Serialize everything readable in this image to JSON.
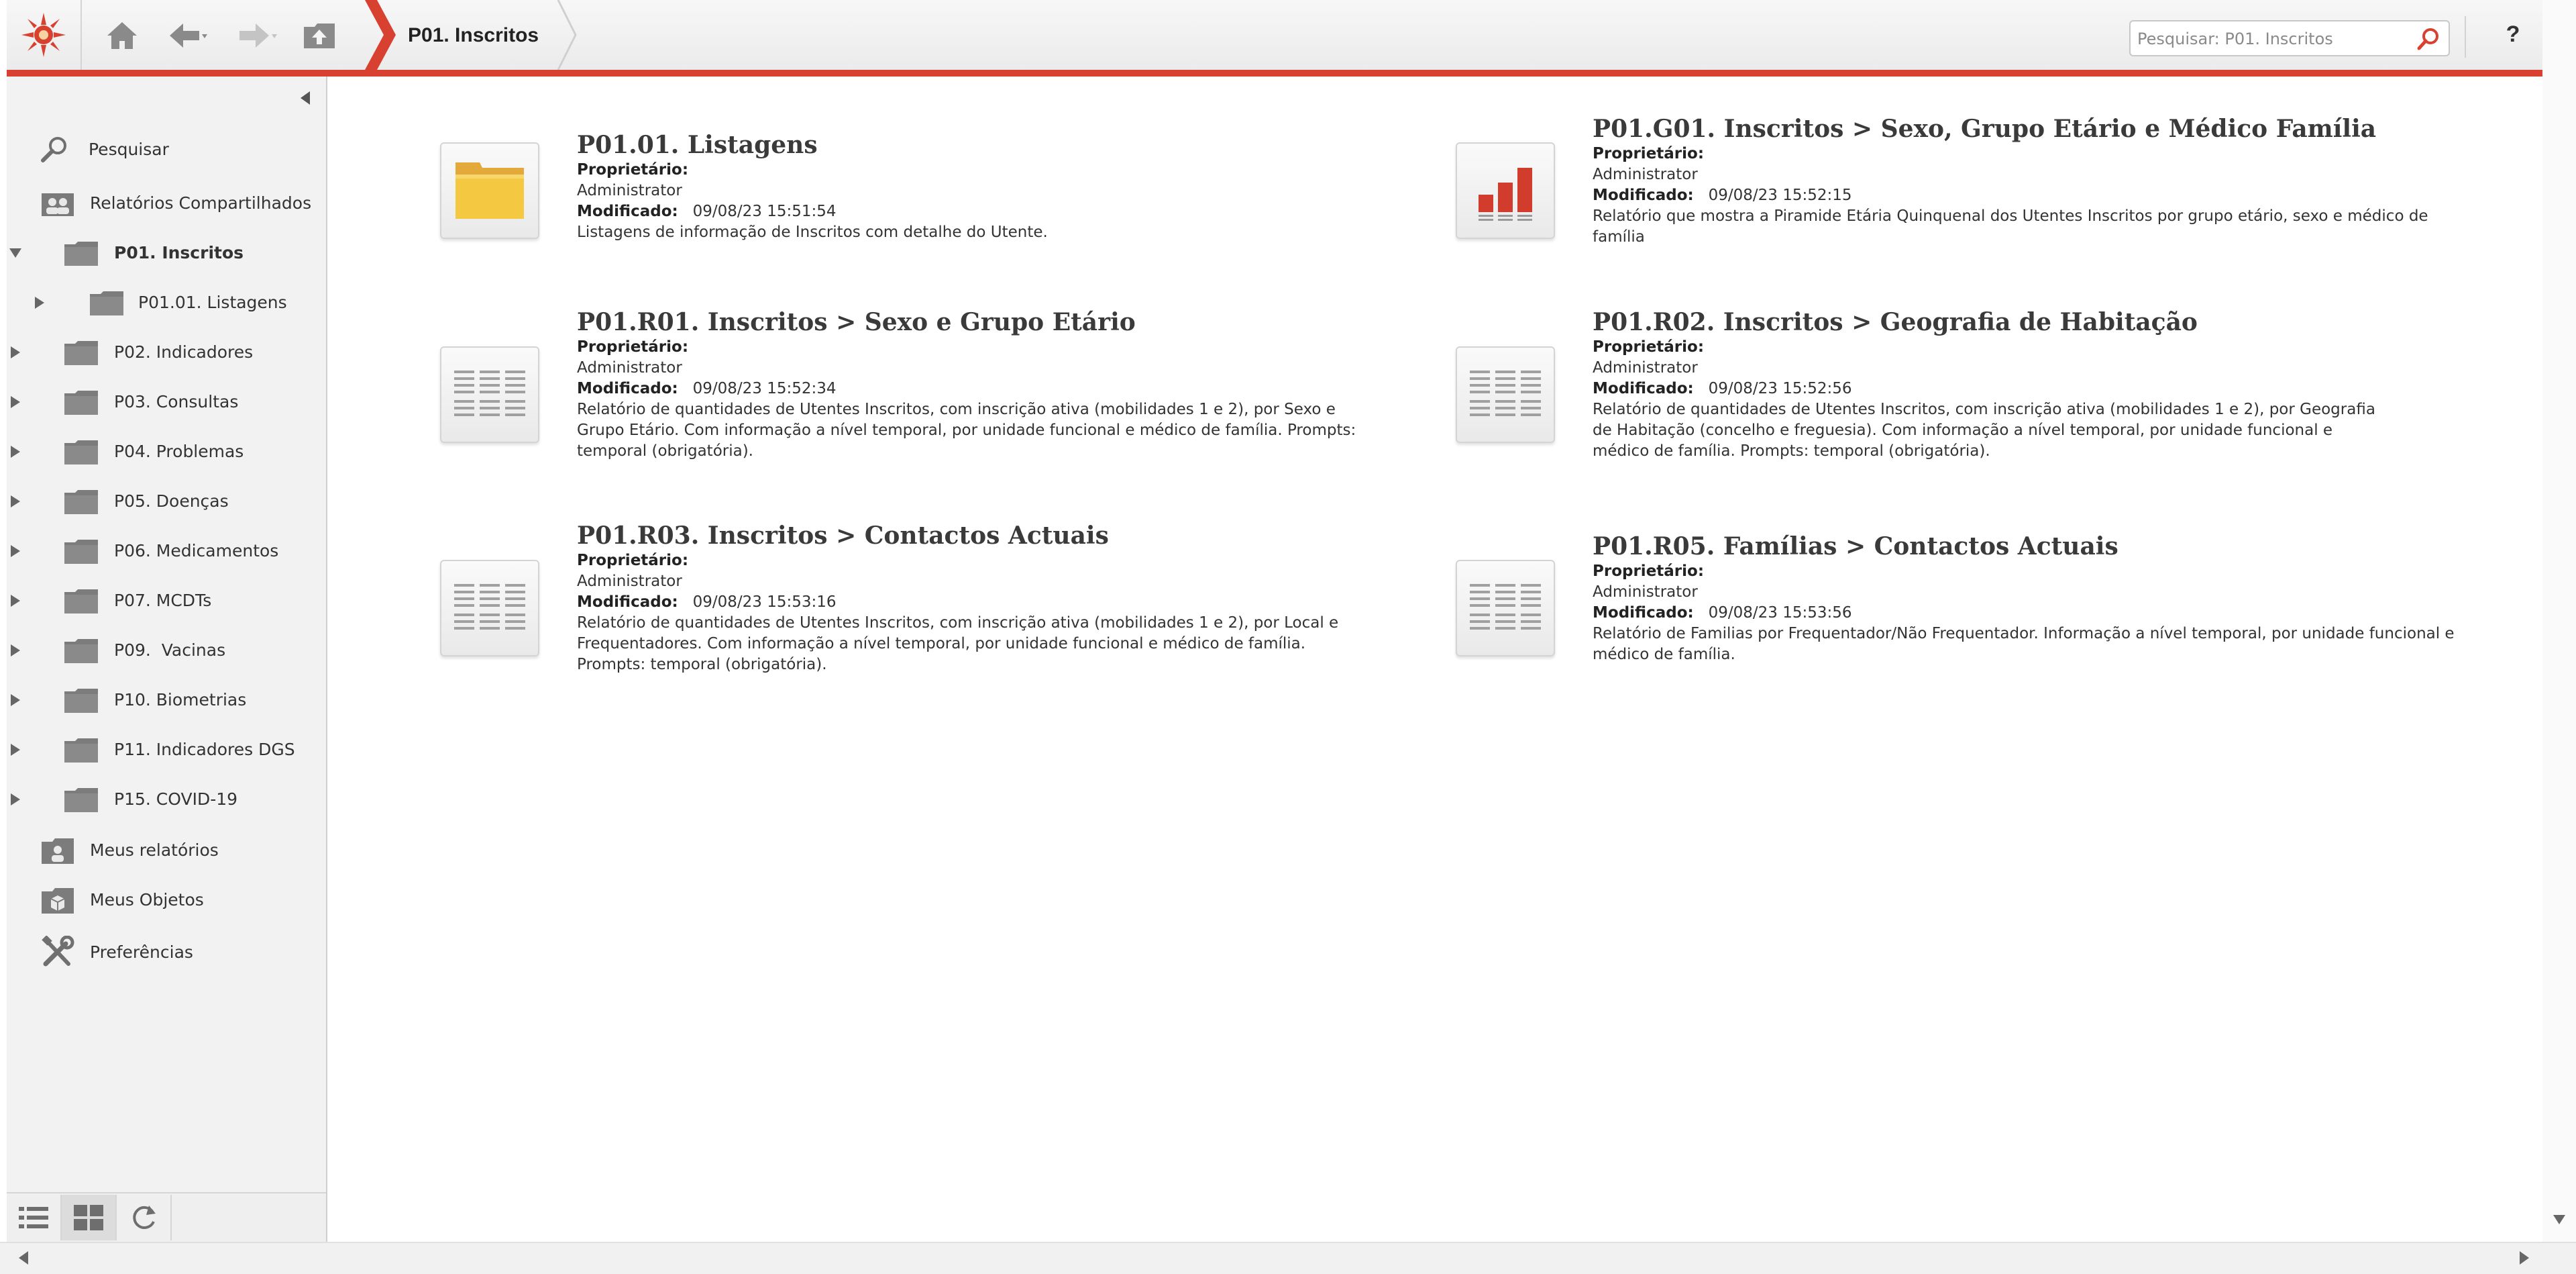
{
  "header": {
    "breadcrumb": "P01. Inscritos",
    "search_placeholder": "Pesquisar: P01. Inscritos",
    "help_label": "?"
  },
  "sidebar": {
    "items": [
      {
        "label": "Pesquisar",
        "icon": "search-icon"
      },
      {
        "label": "Relatórios Compartilhados",
        "icon": "shared-reports-icon"
      },
      {
        "label": "P01. Inscritos",
        "icon": "folder-icon",
        "expanded": true,
        "active": true
      },
      {
        "label": "P01.01. Listagens",
        "icon": "folder-icon"
      },
      {
        "label": "P02. Indicadores",
        "icon": "folder-icon"
      },
      {
        "label": "P03. Consultas",
        "icon": "folder-icon"
      },
      {
        "label": "P04. Problemas",
        "icon": "folder-icon"
      },
      {
        "label": "P05. Doenças",
        "icon": "folder-icon"
      },
      {
        "label": "P06. Medicamentos",
        "icon": "folder-icon"
      },
      {
        "label": "P07. MCDTs",
        "icon": "folder-icon"
      },
      {
        "label": "P09.  Vacinas",
        "icon": "folder-icon"
      },
      {
        "label": "P10. Biometrias",
        "icon": "folder-icon"
      },
      {
        "label": "P11. Indicadores DGS",
        "icon": "folder-icon"
      },
      {
        "label": "P15. COVID-19",
        "icon": "folder-icon"
      },
      {
        "label": "Meus relatórios",
        "icon": "my-reports-icon"
      },
      {
        "label": "Meus Objetos",
        "icon": "my-objects-icon"
      },
      {
        "label": "Preferências",
        "icon": "tools-icon"
      }
    ]
  },
  "cards": [
    {
      "icon": "folder-icon",
      "title": "P01.01. Listagens",
      "owner_label": "Proprietário:",
      "owner": "Administrator",
      "modified_label": "Modificado:",
      "modified": "09/08/23 15:51:54",
      "description": "Listagens de informação de Inscritos com detalhe do Utente."
    },
    {
      "icon": "bar-chart-icon",
      "title": "P01.G01. Inscritos > Sexo, Grupo Etário e Médico Família",
      "owner_label": "Proprietário:",
      "owner": "Administrator",
      "modified_label": "Modificado:",
      "modified": "09/08/23 15:52:15",
      "description": "Relatório que mostra a Piramide Etária Quinquenal dos Utentes Inscritos por grupo etário, sexo e médico de família"
    },
    {
      "icon": "report-grid-icon",
      "title": "P01.R01. Inscritos > Sexo e Grupo Etário",
      "owner_label": "Proprietário:",
      "owner": "Administrator",
      "modified_label": "Modificado:",
      "modified": "09/08/23 15:52:34",
      "description": "Relatório de quantidades de Utentes Inscritos, com inscrição ativa (mobilidades 1 e 2), por Sexo e Grupo Etário. Com informação a nível temporal, por unidade funcional e médico de família. Prompts: temporal (obrigatória)."
    },
    {
      "icon": "report-grid-icon",
      "title": "P01.R02. Inscritos > Geografia de Habitação",
      "owner_label": "Proprietário:",
      "owner": "Administrator",
      "modified_label": "Modificado:",
      "modified": "09/08/23 15:52:56",
      "description": "Relatório de quantidades de Utentes Inscritos, com inscrição ativa (mobilidades 1 e 2), por Geografia de Habitação (concelho e freguesia). Com informação a nível temporal, por unidade funcional e médico de família. Prompts: temporal (obrigatória)."
    },
    {
      "icon": "report-grid-icon",
      "title": "P01.R03. Inscritos > Contactos Actuais",
      "owner_label": "Proprietário:",
      "owner": "Administrator",
      "modified_label": "Modificado:",
      "modified": "09/08/23 15:53:16",
      "description": "Relatório de quantidades de Utentes Inscritos, com inscrição ativa (mobilidades 1 e 2), por Local e Frequentadores. Com informação a nível temporal, por unidade funcional e médico de família. Prompts: temporal (obrigatória)."
    },
    {
      "icon": "report-grid-icon",
      "title": "P01.R05. Famílias > Contactos Actuais",
      "owner_label": "Proprietário:",
      "owner": "Administrator",
      "modified_label": "Modificado:",
      "modified": "09/08/23 15:53:56",
      "description": "Relatório de Familias por Frequentador/Não Frequentador. Informação a nível temporal, por unidade funcional e médico de família."
    }
  ],
  "colors": {
    "accent": "#d8412f",
    "folder": "#f5c842",
    "chart_bars": "#d23c2c"
  }
}
